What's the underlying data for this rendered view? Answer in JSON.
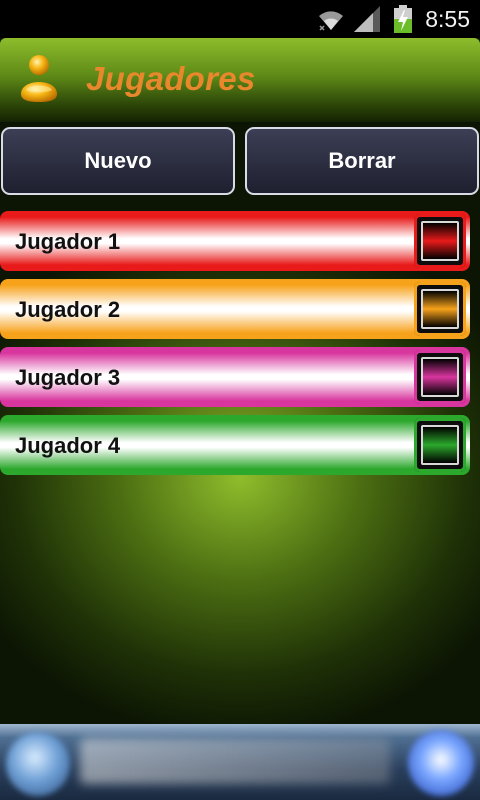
{
  "status_bar": {
    "time": "8:55",
    "icons": [
      "wifi-icon",
      "signal-icon",
      "battery-charging-icon"
    ]
  },
  "header": {
    "title": "Jugadores",
    "icon": "person-icon",
    "accent_color": "#e8872b"
  },
  "buttons": {
    "new_label": "Nuevo",
    "delete_label": "Borrar"
  },
  "players": [
    {
      "label": "Jugador 1",
      "color": "#e81a1a",
      "checked": false
    },
    {
      "label": "Jugador 2",
      "color": "#f7a21b",
      "checked": false
    },
    {
      "label": "Jugador 3",
      "color": "#d8359e",
      "checked": false
    },
    {
      "label": "Jugador 4",
      "color": "#2ca82c",
      "checked": false
    }
  ]
}
